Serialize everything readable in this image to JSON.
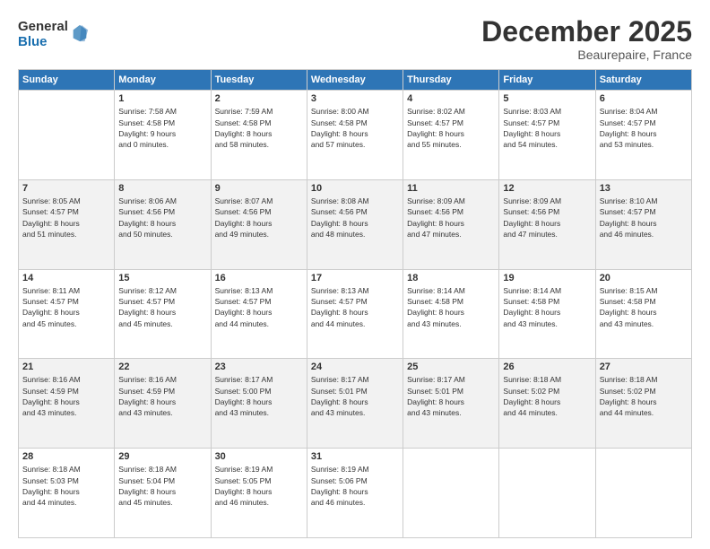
{
  "logo": {
    "general": "General",
    "blue": "Blue"
  },
  "title": "December 2025",
  "subtitle": "Beaurepaire, France",
  "weekdays": [
    "Sunday",
    "Monday",
    "Tuesday",
    "Wednesday",
    "Thursday",
    "Friday",
    "Saturday"
  ],
  "weeks": [
    [
      {
        "day": "",
        "info": ""
      },
      {
        "day": "1",
        "info": "Sunrise: 7:58 AM\nSunset: 4:58 PM\nDaylight: 9 hours\nand 0 minutes."
      },
      {
        "day": "2",
        "info": "Sunrise: 7:59 AM\nSunset: 4:58 PM\nDaylight: 8 hours\nand 58 minutes."
      },
      {
        "day": "3",
        "info": "Sunrise: 8:00 AM\nSunset: 4:58 PM\nDaylight: 8 hours\nand 57 minutes."
      },
      {
        "day": "4",
        "info": "Sunrise: 8:02 AM\nSunset: 4:57 PM\nDaylight: 8 hours\nand 55 minutes."
      },
      {
        "day": "5",
        "info": "Sunrise: 8:03 AM\nSunset: 4:57 PM\nDaylight: 8 hours\nand 54 minutes."
      },
      {
        "day": "6",
        "info": "Sunrise: 8:04 AM\nSunset: 4:57 PM\nDaylight: 8 hours\nand 53 minutes."
      }
    ],
    [
      {
        "day": "7",
        "info": "Sunrise: 8:05 AM\nSunset: 4:57 PM\nDaylight: 8 hours\nand 51 minutes."
      },
      {
        "day": "8",
        "info": "Sunrise: 8:06 AM\nSunset: 4:56 PM\nDaylight: 8 hours\nand 50 minutes."
      },
      {
        "day": "9",
        "info": "Sunrise: 8:07 AM\nSunset: 4:56 PM\nDaylight: 8 hours\nand 49 minutes."
      },
      {
        "day": "10",
        "info": "Sunrise: 8:08 AM\nSunset: 4:56 PM\nDaylight: 8 hours\nand 48 minutes."
      },
      {
        "day": "11",
        "info": "Sunrise: 8:09 AM\nSunset: 4:56 PM\nDaylight: 8 hours\nand 47 minutes."
      },
      {
        "day": "12",
        "info": "Sunrise: 8:09 AM\nSunset: 4:56 PM\nDaylight: 8 hours\nand 47 minutes."
      },
      {
        "day": "13",
        "info": "Sunrise: 8:10 AM\nSunset: 4:57 PM\nDaylight: 8 hours\nand 46 minutes."
      }
    ],
    [
      {
        "day": "14",
        "info": "Sunrise: 8:11 AM\nSunset: 4:57 PM\nDaylight: 8 hours\nand 45 minutes."
      },
      {
        "day": "15",
        "info": "Sunrise: 8:12 AM\nSunset: 4:57 PM\nDaylight: 8 hours\nand 45 minutes."
      },
      {
        "day": "16",
        "info": "Sunrise: 8:13 AM\nSunset: 4:57 PM\nDaylight: 8 hours\nand 44 minutes."
      },
      {
        "day": "17",
        "info": "Sunrise: 8:13 AM\nSunset: 4:57 PM\nDaylight: 8 hours\nand 44 minutes."
      },
      {
        "day": "18",
        "info": "Sunrise: 8:14 AM\nSunset: 4:58 PM\nDaylight: 8 hours\nand 43 minutes."
      },
      {
        "day": "19",
        "info": "Sunrise: 8:14 AM\nSunset: 4:58 PM\nDaylight: 8 hours\nand 43 minutes."
      },
      {
        "day": "20",
        "info": "Sunrise: 8:15 AM\nSunset: 4:58 PM\nDaylight: 8 hours\nand 43 minutes."
      }
    ],
    [
      {
        "day": "21",
        "info": "Sunrise: 8:16 AM\nSunset: 4:59 PM\nDaylight: 8 hours\nand 43 minutes."
      },
      {
        "day": "22",
        "info": "Sunrise: 8:16 AM\nSunset: 4:59 PM\nDaylight: 8 hours\nand 43 minutes."
      },
      {
        "day": "23",
        "info": "Sunrise: 8:17 AM\nSunset: 5:00 PM\nDaylight: 8 hours\nand 43 minutes."
      },
      {
        "day": "24",
        "info": "Sunrise: 8:17 AM\nSunset: 5:01 PM\nDaylight: 8 hours\nand 43 minutes."
      },
      {
        "day": "25",
        "info": "Sunrise: 8:17 AM\nSunset: 5:01 PM\nDaylight: 8 hours\nand 43 minutes."
      },
      {
        "day": "26",
        "info": "Sunrise: 8:18 AM\nSunset: 5:02 PM\nDaylight: 8 hours\nand 44 minutes."
      },
      {
        "day": "27",
        "info": "Sunrise: 8:18 AM\nSunset: 5:02 PM\nDaylight: 8 hours\nand 44 minutes."
      }
    ],
    [
      {
        "day": "28",
        "info": "Sunrise: 8:18 AM\nSunset: 5:03 PM\nDaylight: 8 hours\nand 44 minutes."
      },
      {
        "day": "29",
        "info": "Sunrise: 8:18 AM\nSunset: 5:04 PM\nDaylight: 8 hours\nand 45 minutes."
      },
      {
        "day": "30",
        "info": "Sunrise: 8:19 AM\nSunset: 5:05 PM\nDaylight: 8 hours\nand 46 minutes."
      },
      {
        "day": "31",
        "info": "Sunrise: 8:19 AM\nSunset: 5:06 PM\nDaylight: 8 hours\nand 46 minutes."
      },
      {
        "day": "",
        "info": ""
      },
      {
        "day": "",
        "info": ""
      },
      {
        "day": "",
        "info": ""
      }
    ]
  ]
}
